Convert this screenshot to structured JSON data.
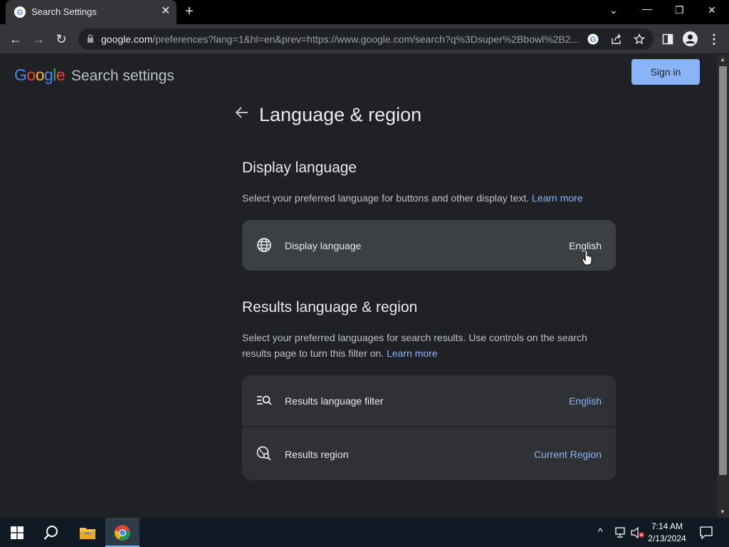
{
  "browser": {
    "tab_title": "Search Settings",
    "url_host": "google.com",
    "url_rest": "/preferences?lang=1&hl=en&prev=https://www.google.com/search?q%3Dsuper%2Bbowl%2B2..."
  },
  "header": {
    "logo_text": "Google",
    "settings_title": "Search settings",
    "signin_label": "Sign in"
  },
  "page": {
    "title": "Language & region",
    "display": {
      "heading": "Display language",
      "description": "Select your preferred language for buttons and other display text.",
      "learn_more": "Learn more",
      "card_label": "Display language",
      "card_value": "English"
    },
    "results": {
      "heading": "Results language & region",
      "description": "Select your preferred languages for search results. Use controls on the search results page to turn this filter on.",
      "learn_more": "Learn more",
      "filter_label": "Results language filter",
      "filter_value": "English",
      "region_label": "Results region",
      "region_value": "Current Region"
    }
  },
  "taskbar": {
    "time": "7:14 AM",
    "date": "2/13/2024"
  },
  "colors": {
    "accent": "#8ab4f8",
    "page_bg": "#202124",
    "card_bg": "#303134"
  }
}
